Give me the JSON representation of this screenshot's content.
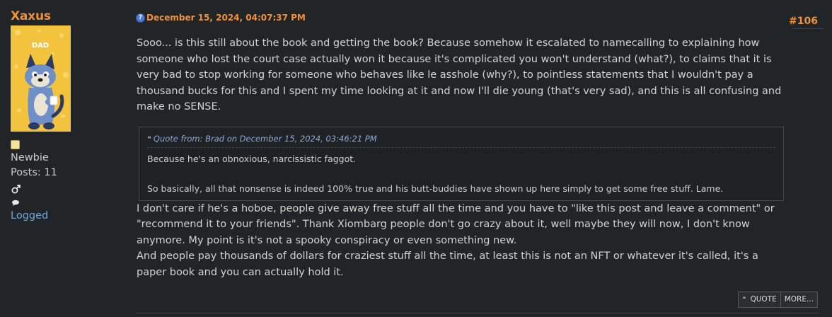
{
  "poster": {
    "name": "Xaxus",
    "group": "Newbie",
    "posts": "Posts: 11",
    "status": "Logged",
    "avatar_text": "DAD"
  },
  "post": {
    "date": "December 15, 2024, 04:07:37 PM",
    "number": "#106",
    "paragraph1": "Sooo... is this still about the book and getting the book? Because somehow it escalated to namecalling to explaining how someone who lost the court case actually won it because it's complicated you won't understand (what?), to claims that it is very bad to stop working for someone who behaves like le asshole (why?), to pointless statements that I wouldn't pay a thousand bucks for this and I spent my time looking at it and now I'll die young (that's very sad), and this is all confusing and make no SENSE.",
    "quote": {
      "header": "Quote from: Brad on December 15, 2024, 03:46:21 PM",
      "line1": "Because he's an obnoxious, narcissistic faggot.",
      "line2": "So basically, all that nonsense is indeed 100% true and his butt-buddies have shown up here simply to get some free stuff. Lame."
    },
    "paragraph2": "I don't care if he's a hoboe, people give away free stuff all the time and you have to \"like this post and leave a comment\" or \"recommend it to your friends\". Thank Xiombarg people don't go crazy about it, well maybe they will now, I don't know anymore. My point is it's not a spooky conspiracy or even something new.",
    "paragraph3": "And people pay thousands of dollars for craziest stuff all the time, at least this is not an NFT or whatever it's called, it's a paper book and you can actually hold it."
  },
  "actions": {
    "quote_label": "QUOTE",
    "more_label": "MORE..."
  },
  "colors": {
    "background": "#222527",
    "accent": "#f0913a",
    "link": "#6ea6dc",
    "quote_header": "#8faad7"
  }
}
